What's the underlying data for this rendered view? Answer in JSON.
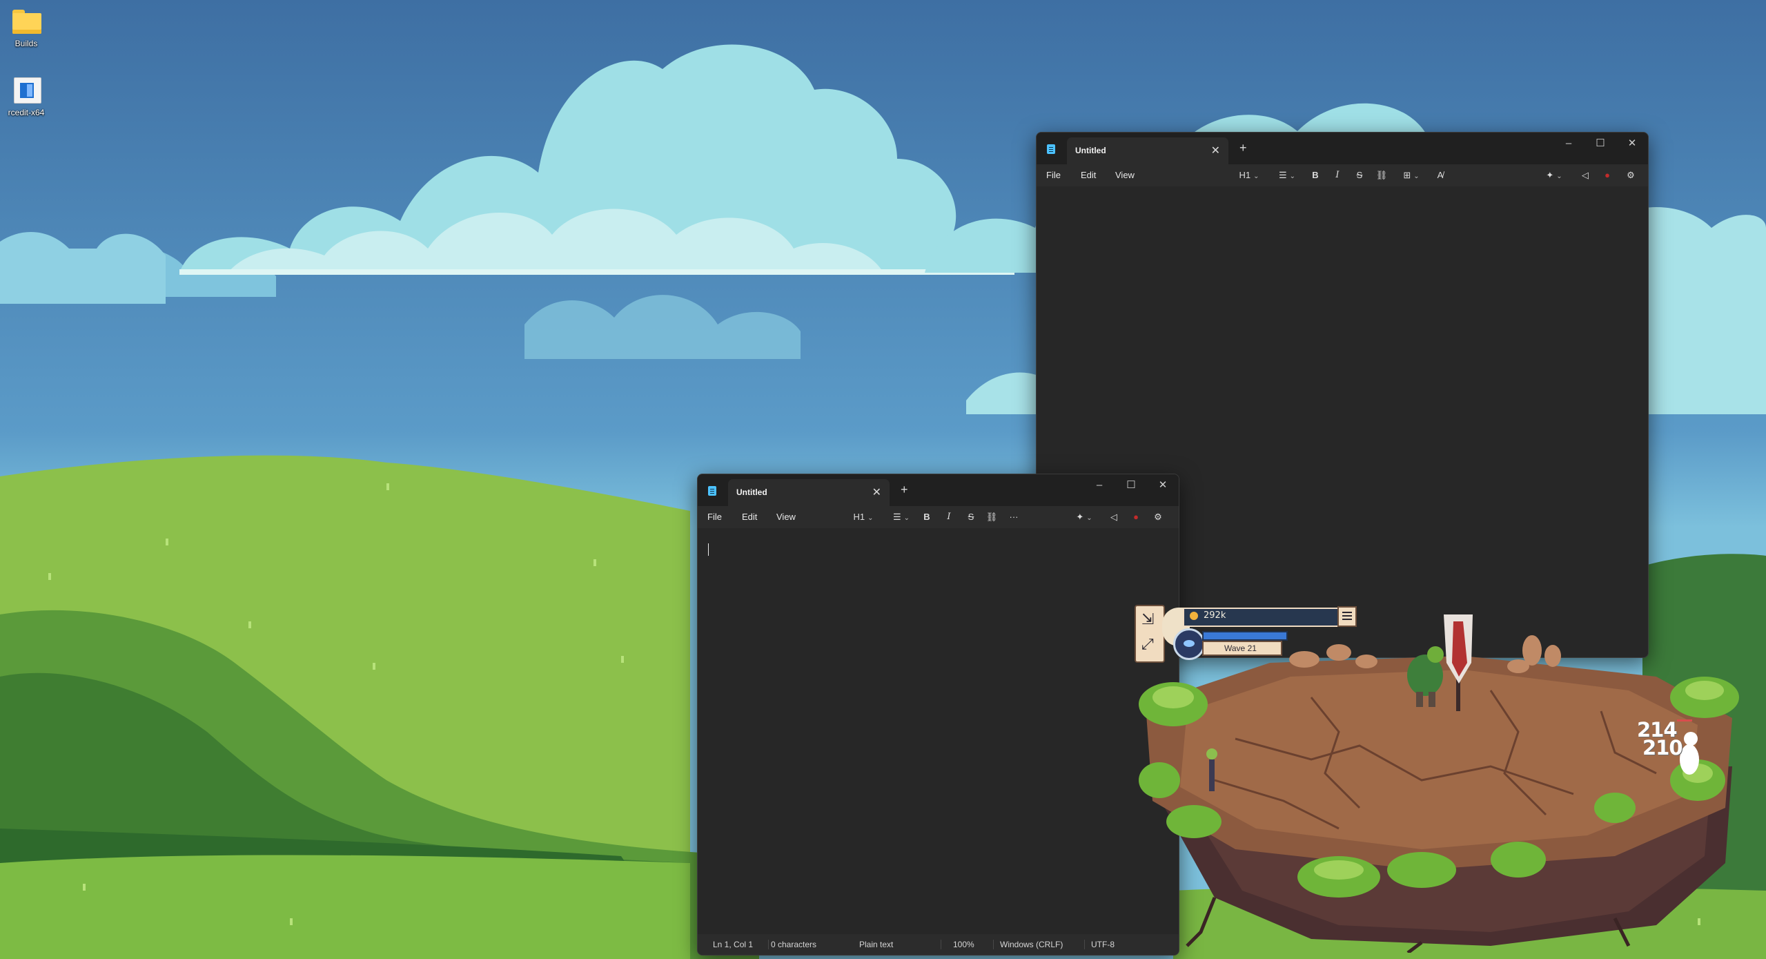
{
  "desktop": {
    "icons": [
      {
        "label": "Builds",
        "icon": "folder-icon"
      },
      {
        "label": "rcedit-x64",
        "icon": "executable-icon"
      }
    ]
  },
  "back_window": {
    "tab_title": "Untitled",
    "menu": [
      "File",
      "Edit",
      "View"
    ],
    "heading_label": "H1"
  },
  "front_window": {
    "tab_title": "Untitled",
    "menu": [
      "File",
      "Edit",
      "View"
    ],
    "heading_label": "H1",
    "more_label": "···",
    "status": {
      "position": "Ln 1, Col 1",
      "characters": "0 characters",
      "format": "Plain text",
      "zoom": "100%",
      "line_ending": "Windows (CRLF)",
      "encoding": "UTF-8"
    }
  },
  "game": {
    "gold": "292k",
    "wave": "Wave 21",
    "damage_numbers": [
      "214",
      "210"
    ]
  },
  "colors": {
    "notepad_bg": "#272727",
    "notepad_chrome": "#202020",
    "accent": "#4cc2ff",
    "record_red": "#c22b2b"
  }
}
